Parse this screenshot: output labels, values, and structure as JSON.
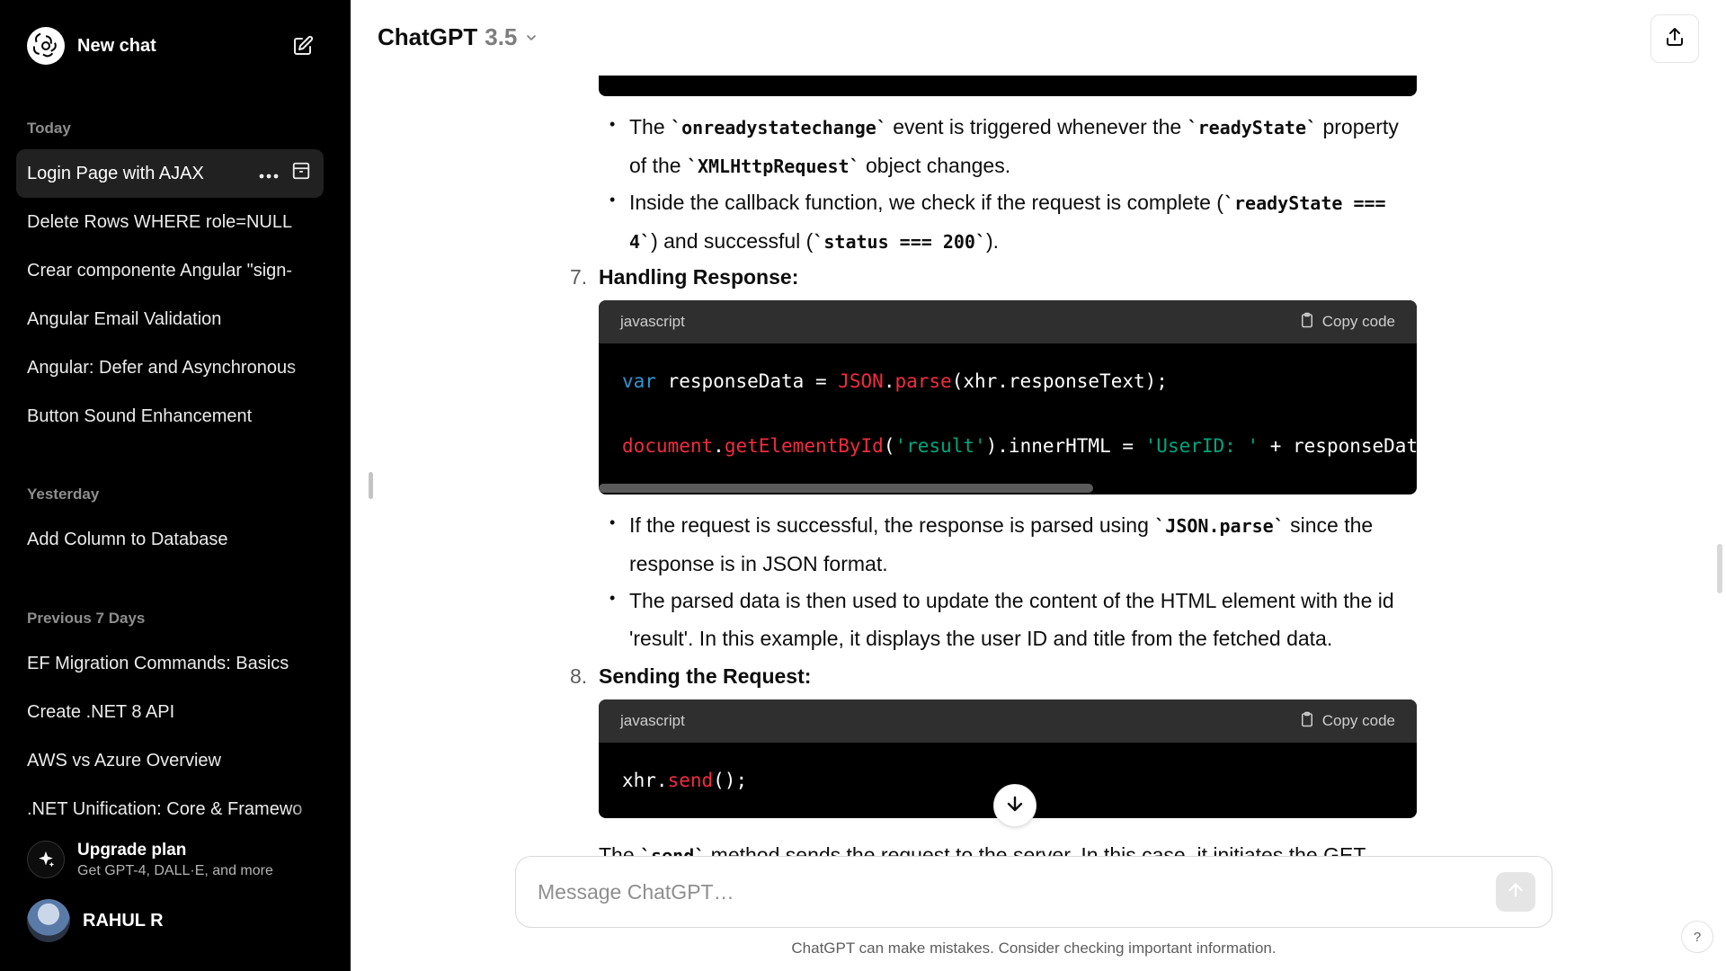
{
  "sidebar": {
    "new_chat": "New chat",
    "sections": {
      "today": "Today",
      "yesterday": "Yesterday",
      "previous7": "Previous 7 Days"
    },
    "items": [
      {
        "label": "Login Page with AJAX"
      },
      {
        "label": "Delete Rows WHERE role=NULL"
      },
      {
        "label": "Crear componente Angular \"sign-"
      },
      {
        "label": "Angular Email Validation"
      },
      {
        "label": "Angular: Defer and Asynchronous"
      },
      {
        "label": "Button Sound Enhancement"
      },
      {
        "label": "Add Column to Database"
      },
      {
        "label": "EF Migration Commands: Basics"
      },
      {
        "label": "Create .NET 8 API"
      },
      {
        "label": "AWS vs Azure Overview"
      },
      {
        "label": ".NET Unification: Core & Framewo"
      }
    ],
    "upgrade": {
      "title": "Upgrade plan",
      "subtitle": "Get GPT-4, DALL·E, and more"
    },
    "user": {
      "name": "RAHUL R"
    }
  },
  "header": {
    "model_name": "ChatGPT",
    "model_version": "3.5"
  },
  "content": {
    "bullets_top": [
      {
        "pre": "The ",
        "code1": "`onreadystatechange`",
        "mid": " event is triggered whenever the ",
        "code2": "`readyState`",
        "post": " property of the ",
        "code3": "`XMLHttpRequest`",
        "end": " object changes."
      },
      {
        "pre": "Inside the callback function, we check if the request is complete (",
        "code1": "`readyState === 4`",
        "mid": ") and successful (",
        "code2": "`status === 200`",
        "end": ")."
      }
    ],
    "step7": {
      "num": "7.",
      "title": "Handling Response:"
    },
    "code1": {
      "lang": "javascript",
      "copy": "Copy code",
      "line1": {
        "kw": "var",
        "a": " responseData = ",
        "b": "JSON",
        "c": ".",
        "d": "parse",
        "e": "(xhr.responseText);"
      },
      "line2": {
        "a": "document",
        "b": ".",
        "c": "getElementById",
        "d": "(",
        "e": "'result'",
        "f": ").innerHTML = ",
        "g": "'UserID: '",
        "h": " + responseData"
      }
    },
    "bullets_mid": [
      {
        "pre": "If the request is successful, the response is parsed using ",
        "code1": "`JSON.parse`",
        "end": " since the response is in JSON format."
      },
      {
        "text": "The parsed data is then used to update the content of the HTML element with the id 'result'. In this example, it displays the user ID and title from the fetched data."
      }
    ],
    "step8": {
      "num": "8.",
      "title": "Sending the Request:"
    },
    "code2": {
      "lang": "javascript",
      "copy": "Copy code",
      "line1": {
        "a": "xhr.",
        "b": "send",
        "c": "();"
      }
    },
    "partial": {
      "pre": "The ",
      "code": "`send`",
      "post": " method sends the request to the server. In this case, it initiates the GET"
    }
  },
  "composer": {
    "placeholder": "Message ChatGPT…"
  },
  "footer": {
    "disclaimer": "ChatGPT can make mistakes. Consider checking important information.",
    "help": "?"
  }
}
